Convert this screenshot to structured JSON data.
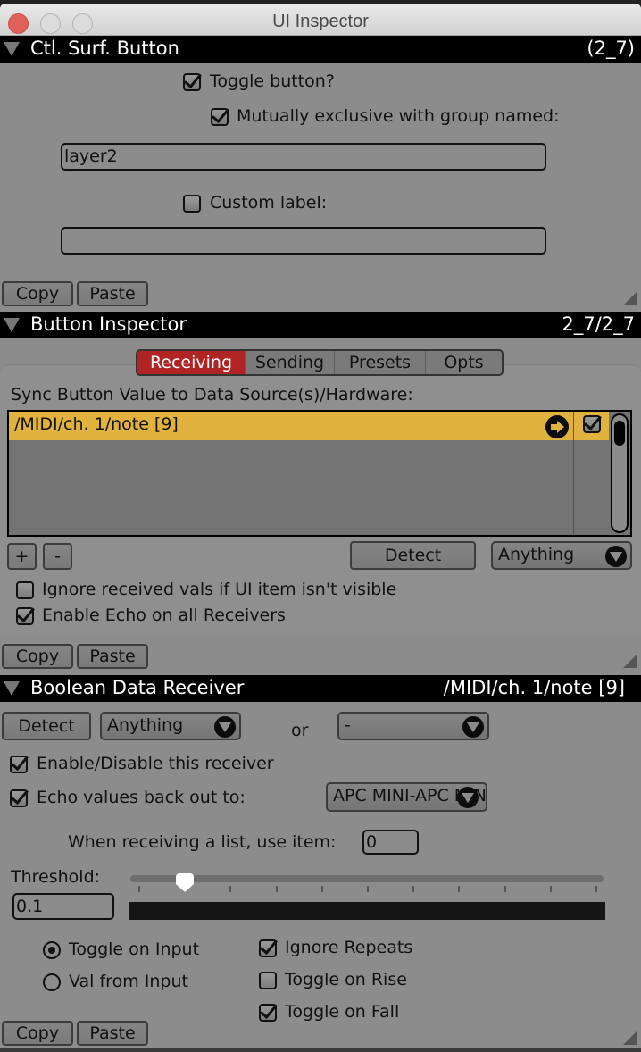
{
  "window": {
    "title": "UI Inspector"
  },
  "ctl_surf_button": {
    "title": "Ctl. Surf. Button",
    "id": "(2_7)",
    "toggle_button": {
      "label": "Toggle button?",
      "checked": true
    },
    "mutually_exclusive": {
      "label": "Mutually exclusive with group named:",
      "checked": true
    },
    "group_name_value": "layer2",
    "custom_label": {
      "label": "Custom label:",
      "checked": false
    },
    "custom_label_value": "",
    "copy_label": "Copy",
    "paste_label": "Paste"
  },
  "button_inspector": {
    "title": "Button Inspector",
    "id": "2_7/2_7",
    "tabs": [
      {
        "label": "Receiving",
        "active": true
      },
      {
        "label": "Sending",
        "active": false
      },
      {
        "label": "Presets",
        "active": false
      },
      {
        "label": "Opts",
        "active": false
      }
    ],
    "sync_label": "Sync Button Value to Data Source(s)/Hardware:",
    "sources": [
      {
        "path": "/MIDI/ch. 1/note [9]",
        "enabled": true,
        "selected": true
      }
    ],
    "add_label": "+",
    "remove_label": "-",
    "detect_label": "Detect",
    "filter_popup": "Anything",
    "ignore_invisible": {
      "label": "Ignore received vals if UI item isn't visible",
      "checked": false
    },
    "enable_echo": {
      "label": "Enable Echo on all Receivers",
      "checked": true
    },
    "copy_label": "Copy",
    "paste_label": "Paste"
  },
  "boolean_receiver": {
    "title": "Boolean Data Receiver",
    "id": "/MIDI/ch. 1/note [9]",
    "detect_label": "Detect",
    "type_popup": "Anything",
    "or_label": "or",
    "second_popup": "-",
    "enable_receiver": {
      "label": "Enable/Disable this receiver",
      "checked": true
    },
    "echo_values": {
      "label": "Echo values back out to:",
      "checked": true
    },
    "echo_target_popup": "APC MINI-APC MINI",
    "list_item_label": "When receiving a list, use item:",
    "list_item_value": "0",
    "threshold_label": "Threshold:",
    "threshold_value": "0.1",
    "threshold_fraction": 0.1,
    "slider_tick_count": 11,
    "mode_options": [
      {
        "label": "Toggle on Input",
        "selected": true
      },
      {
        "label": "Val from Input",
        "selected": false
      }
    ],
    "ignore_repeats": {
      "label": "Ignore Repeats",
      "checked": true
    },
    "toggle_on_rise": {
      "label": "Toggle on Rise",
      "checked": false
    },
    "toggle_on_fall": {
      "label": "Toggle on Fall",
      "checked": true
    },
    "copy_label": "Copy",
    "paste_label": "Paste"
  },
  "colors": {
    "active_tab": "#b02424",
    "selected_row": "#e2b23e",
    "panel_bg": "#8c8c8c",
    "header_bg": "#000000"
  }
}
